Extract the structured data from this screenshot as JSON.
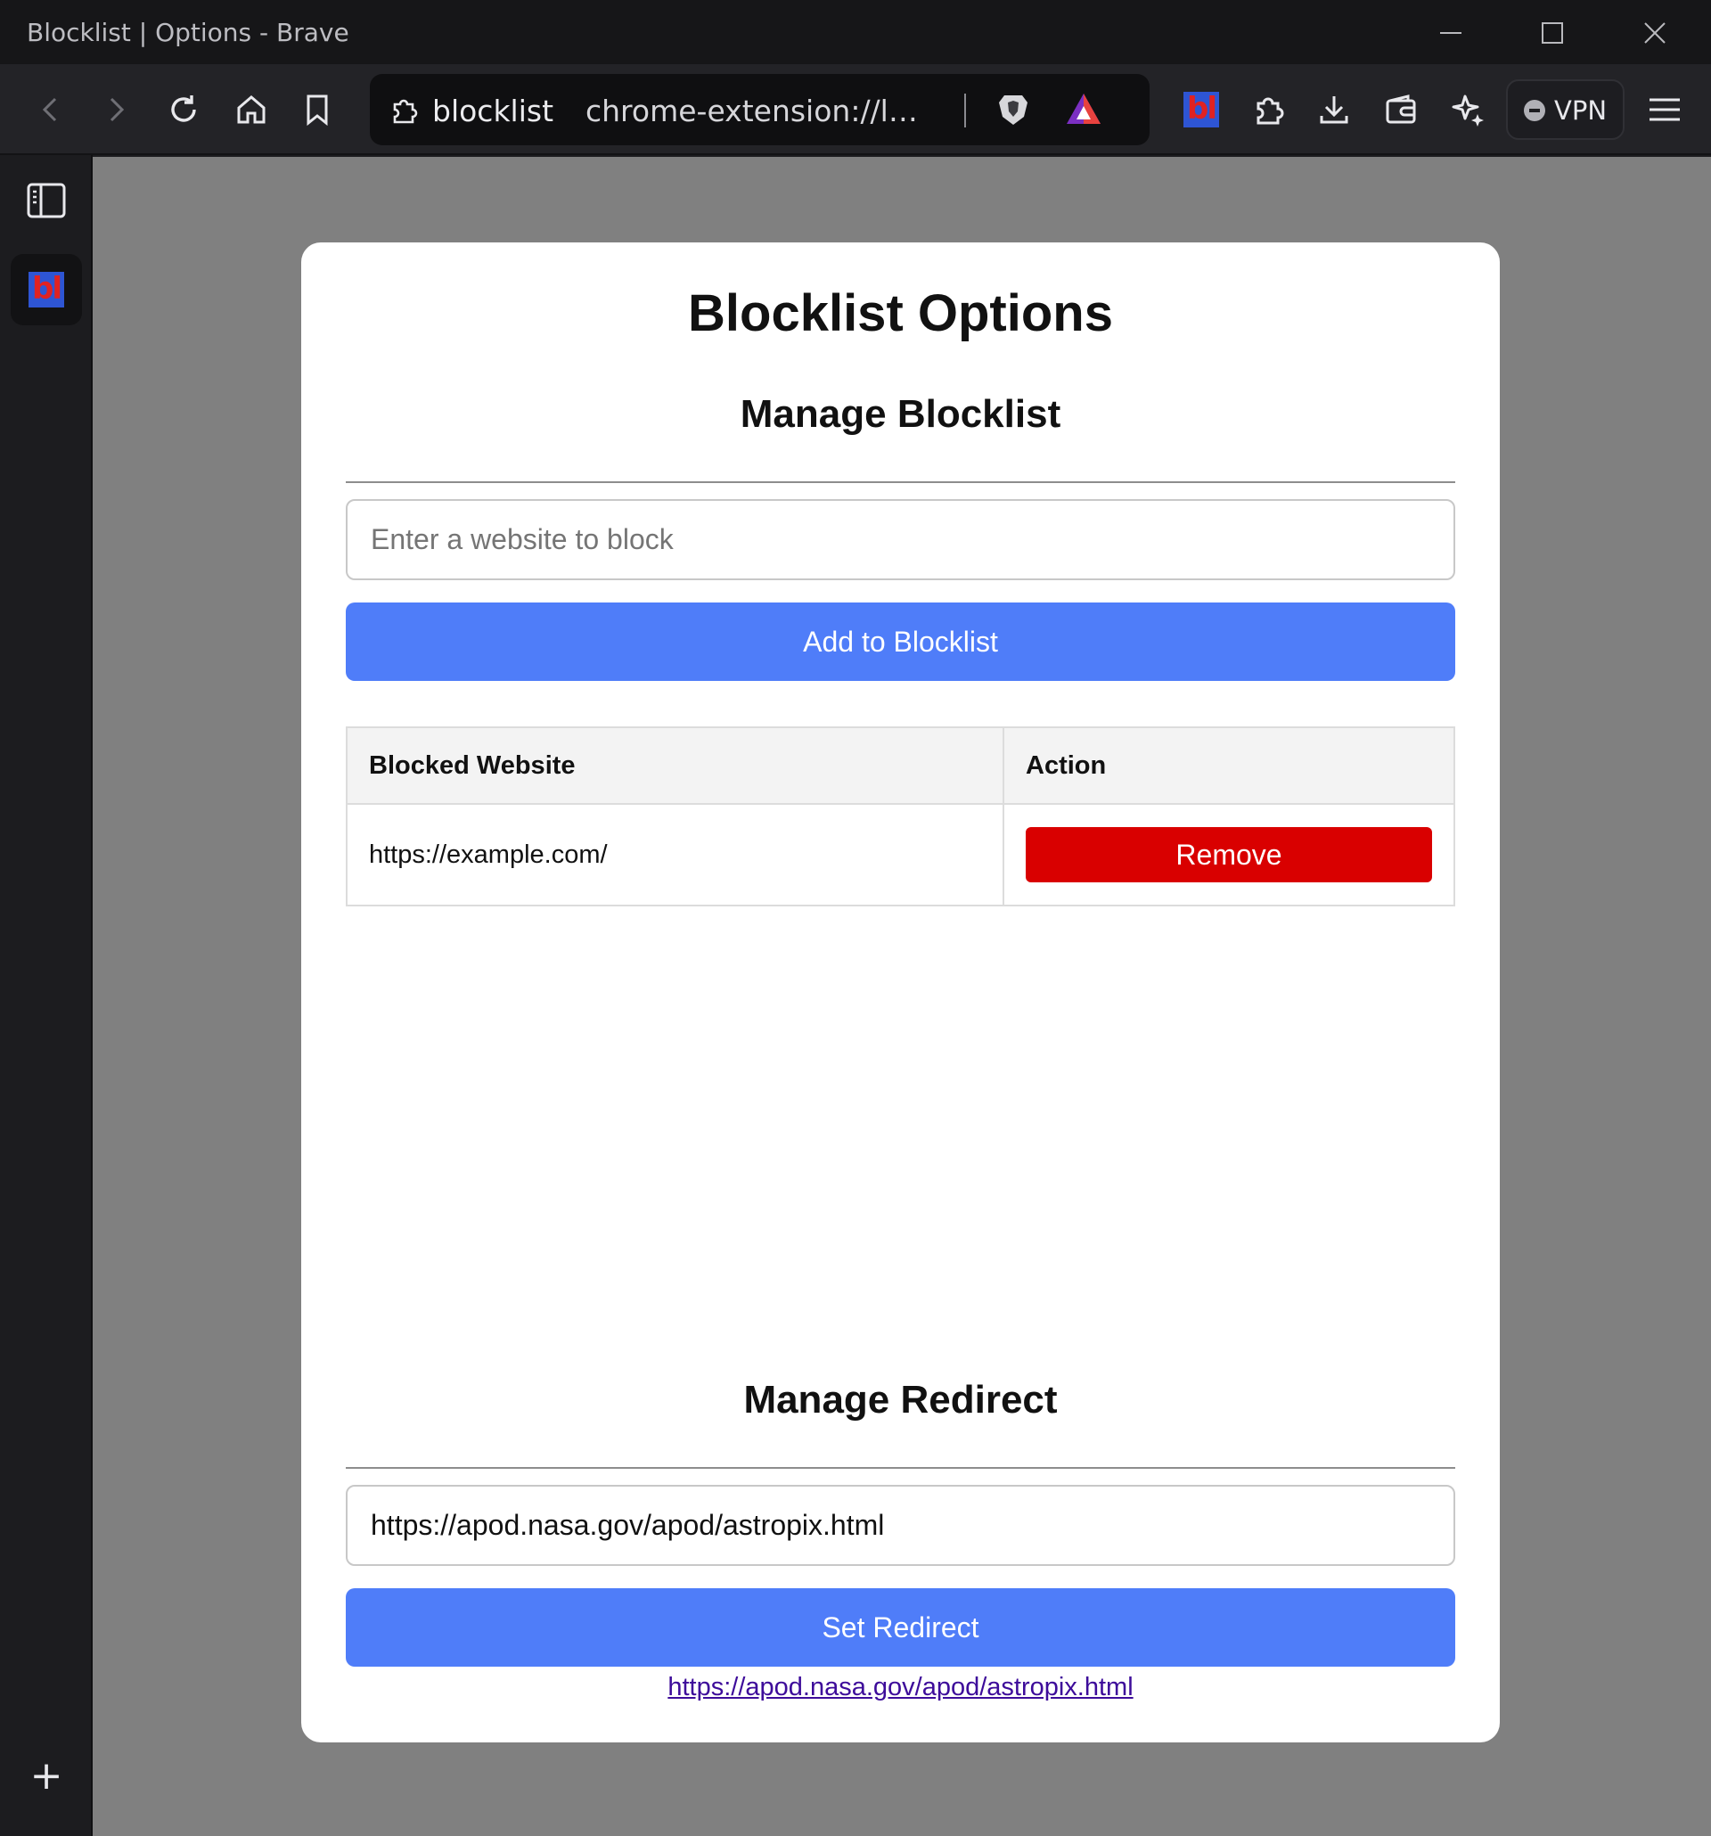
{
  "window": {
    "title": "Blocklist | Options - Brave"
  },
  "toolbar": {
    "site_name": "blocklist",
    "url": "chrome-extension://la...",
    "vpn_label": "VPN",
    "extension_badge": "bl"
  },
  "sidebar": {
    "extension_badge": "bl",
    "add_label": "+"
  },
  "page": {
    "title": "Blocklist Options",
    "blocklist_section": {
      "heading": "Manage Blocklist",
      "input_placeholder": "Enter a website to block",
      "add_button": "Add to Blocklist",
      "table": {
        "headers": [
          "Blocked Website",
          "Action"
        ],
        "rows": [
          {
            "website": "https://example.com/",
            "action": "Remove"
          }
        ]
      }
    },
    "redirect_section": {
      "heading": "Manage Redirect",
      "input_value": "https://apod.nasa.gov/apod/astropix.html",
      "set_button": "Set Redirect",
      "current_link": "https://apod.nasa.gov/apod/astropix.html"
    }
  },
  "colors": {
    "accent_blue": "#4f7df9",
    "remove_red": "#d90000",
    "page_background": "#808080"
  }
}
